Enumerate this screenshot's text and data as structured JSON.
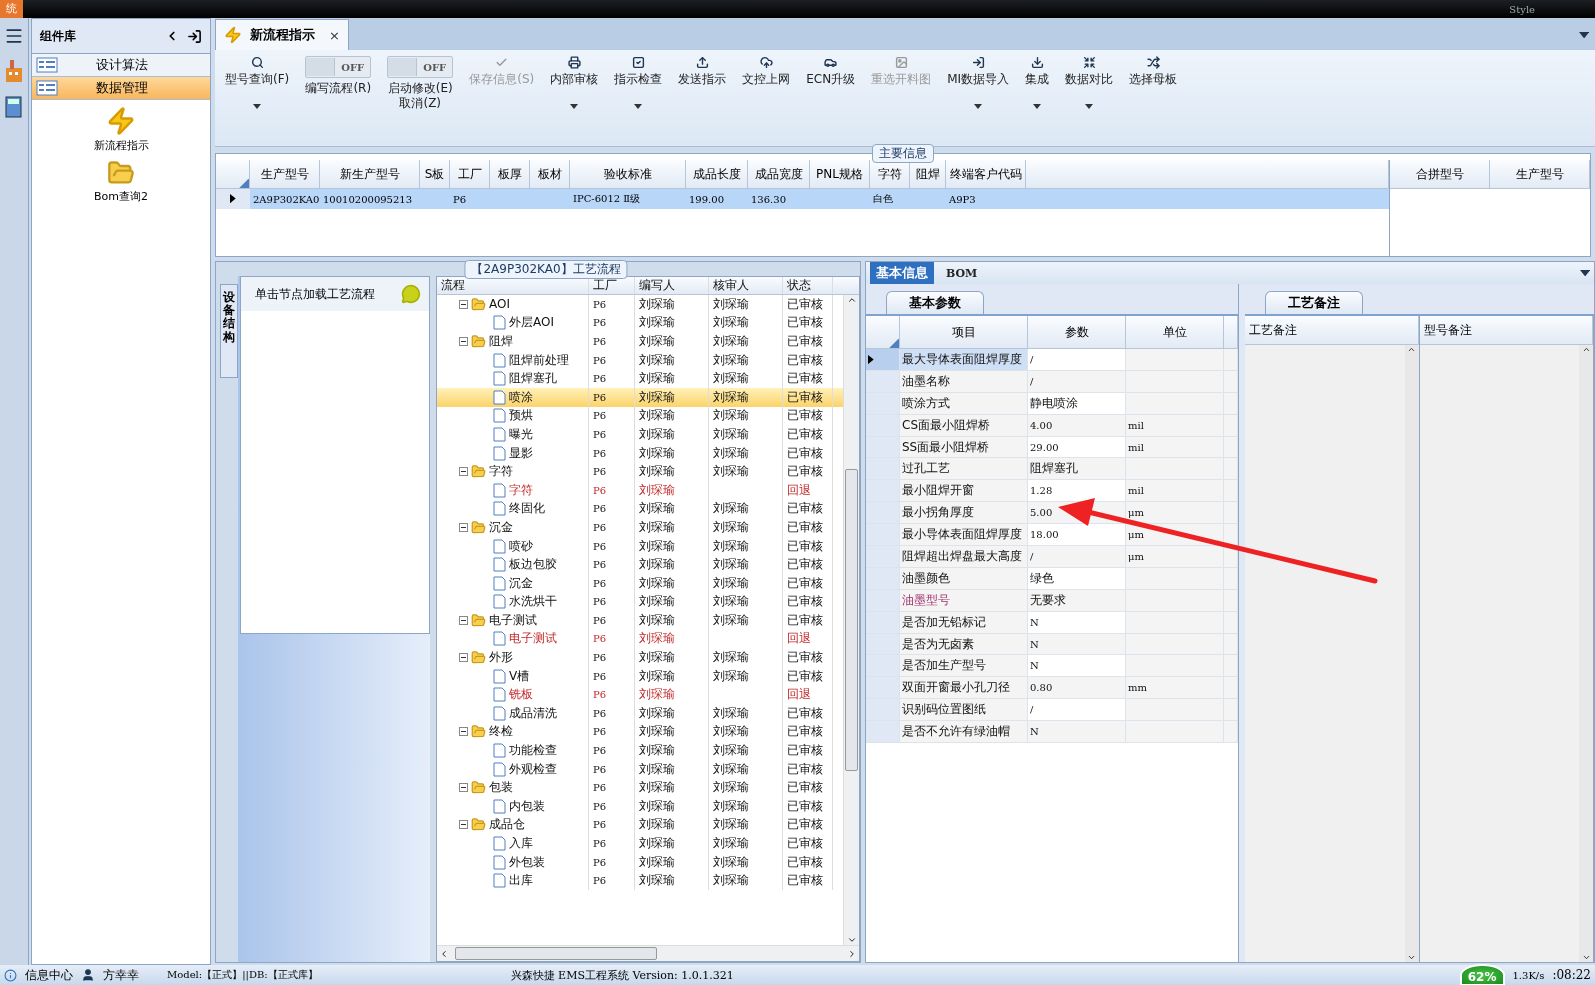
{
  "title_bar": {
    "app_fragment": "统",
    "style_menu": "Style"
  },
  "component_library": {
    "title": "组件库",
    "items": [
      {
        "label": "设计算法",
        "selected": false
      },
      {
        "label": "数据管理",
        "selected": true
      }
    ],
    "tools": [
      {
        "label": "新流程指示",
        "kind": "lightning"
      },
      {
        "label": "Bom查询2",
        "kind": "folder"
      }
    ]
  },
  "document_tab": {
    "label": "新流程指示",
    "close": "×"
  },
  "toolbar": [
    {
      "kind": "button",
      "label": "型号查询(F)",
      "disabled": false,
      "dropdown": true
    },
    {
      "kind": "toggle",
      "label": "编写流程(R)",
      "switch": "OFF",
      "on": false
    },
    {
      "kind": "toggle",
      "label": "启动修改(E)\n取消(Z)",
      "switch": "OFF",
      "on": false
    },
    {
      "kind": "button",
      "label": "保存信息(S)",
      "disabled": true,
      "dropdown": false
    },
    {
      "kind": "button",
      "label": "内部审核",
      "disabled": false,
      "dropdown": true
    },
    {
      "kind": "button",
      "label": "指示检查",
      "disabled": false,
      "dropdown": true
    },
    {
      "kind": "button",
      "label": "发送指示",
      "disabled": false,
      "dropdown": false
    },
    {
      "kind": "button",
      "label": "文控上网",
      "disabled": false,
      "dropdown": false
    },
    {
      "kind": "button",
      "label": "ECN升级",
      "disabled": false,
      "dropdown": false
    },
    {
      "kind": "button",
      "label": "重选开料图",
      "disabled": true,
      "dropdown": false
    },
    {
      "kind": "button",
      "label": "MI数据导入",
      "disabled": false,
      "dropdown": true
    },
    {
      "kind": "button",
      "label": "集成",
      "disabled": false,
      "dropdown": true
    },
    {
      "kind": "button",
      "label": "数据对比",
      "disabled": false,
      "dropdown": true
    },
    {
      "kind": "button",
      "label": "选择母板",
      "disabled": false,
      "dropdown": false
    }
  ],
  "main_info": {
    "title": "主要信息",
    "columns": [
      "生产型号",
      "新生产型号",
      "S板",
      "工厂",
      "板厚",
      "板材",
      "验收标准",
      "成品长度",
      "成品宽度",
      "PNL规格",
      "字符",
      "阻焊",
      "终端客户代码"
    ],
    "rows": [
      {
        "selected": true,
        "cells": [
          "2A9P302KA0",
          "10010200095213",
          "",
          "P6",
          "",
          "",
          "IPC-6012 Ⅱ级",
          "199.00",
          "136.30",
          "",
          "白色",
          "",
          "A9P3"
        ]
      }
    ],
    "side_columns": [
      "合拼型号",
      "生产型号"
    ]
  },
  "process": {
    "title": "【2A9P302KA0】工艺流程",
    "side_tab": "设备结构",
    "hint": "单击节点加载工艺流程",
    "columns": [
      "流程",
      "工厂",
      "编写人",
      "核审人",
      "状态"
    ],
    "tree": [
      {
        "name": "AOI",
        "factory": "P6",
        "writer": "刘琛瑜",
        "reviewer": "刘琛瑜",
        "status": "已审核",
        "returned": false,
        "selected": false,
        "children": [
          {
            "name": "外层AOI",
            "factory": "P6",
            "writer": "刘琛瑜",
            "reviewer": "刘琛瑜",
            "status": "已审核",
            "returned": false,
            "selected": false
          }
        ]
      },
      {
        "name": "阻焊",
        "factory": "P6",
        "writer": "刘琛瑜",
        "reviewer": "刘琛瑜",
        "status": "已审核",
        "returned": false,
        "selected": false,
        "children": [
          {
            "name": "阻焊前处理",
            "factory": "P6",
            "writer": "刘琛瑜",
            "reviewer": "刘琛瑜",
            "status": "已审核",
            "returned": false,
            "selected": false
          },
          {
            "name": "阻焊塞孔",
            "factory": "P6",
            "writer": "刘琛瑜",
            "reviewer": "刘琛瑜",
            "status": "已审核",
            "returned": false,
            "selected": false
          },
          {
            "name": "喷涂",
            "factory": "P6",
            "writer": "刘琛瑜",
            "reviewer": "刘琛瑜",
            "status": "已审核",
            "returned": false,
            "selected": true
          },
          {
            "name": "预烘",
            "factory": "P6",
            "writer": "刘琛瑜",
            "reviewer": "刘琛瑜",
            "status": "已审核",
            "returned": false,
            "selected": false
          },
          {
            "name": "曝光",
            "factory": "P6",
            "writer": "刘琛瑜",
            "reviewer": "刘琛瑜",
            "status": "已审核",
            "returned": false,
            "selected": false
          },
          {
            "name": "显影",
            "factory": "P6",
            "writer": "刘琛瑜",
            "reviewer": "刘琛瑜",
            "status": "已审核",
            "returned": false,
            "selected": false
          }
        ]
      },
      {
        "name": "字符",
        "factory": "P6",
        "writer": "刘琛瑜",
        "reviewer": "刘琛瑜",
        "status": "已审核",
        "returned": false,
        "selected": false,
        "children": [
          {
            "name": "字符",
            "factory": "P6",
            "writer": "刘琛瑜",
            "status": "回退",
            "returned": true,
            "selected": false
          },
          {
            "name": "终固化",
            "factory": "P6",
            "writer": "刘琛瑜",
            "reviewer": "刘琛瑜",
            "status": "已审核",
            "returned": false,
            "selected": false
          }
        ]
      },
      {
        "name": "沉金",
        "factory": "P6",
        "writer": "刘琛瑜",
        "reviewer": "刘琛瑜",
        "status": "已审核",
        "returned": false,
        "selected": false,
        "children": [
          {
            "name": "喷砂",
            "factory": "P6",
            "writer": "刘琛瑜",
            "reviewer": "刘琛瑜",
            "status": "已审核",
            "returned": false,
            "selected": false
          },
          {
            "name": "板边包胶",
            "factory": "P6",
            "writer": "刘琛瑜",
            "reviewer": "刘琛瑜",
            "status": "已审核",
            "returned": false,
            "selected": false
          },
          {
            "name": "沉金",
            "factory": "P6",
            "writer": "刘琛瑜",
            "reviewer": "刘琛瑜",
            "status": "已审核",
            "returned": false,
            "selected": false
          },
          {
            "name": "水洗烘干",
            "factory": "P6",
            "writer": "刘琛瑜",
            "reviewer": "刘琛瑜",
            "status": "已审核",
            "returned": false,
            "selected": false
          }
        ]
      },
      {
        "name": "电子测试",
        "factory": "P6",
        "writer": "刘琛瑜",
        "reviewer": "刘琛瑜",
        "status": "已审核",
        "returned": false,
        "selected": false,
        "children": [
          {
            "name": "电子测试",
            "factory": "P6",
            "writer": "刘琛瑜",
            "status": "回退",
            "returned": true,
            "selected": false
          }
        ]
      },
      {
        "name": "外形",
        "factory": "P6",
        "writer": "刘琛瑜",
        "reviewer": "刘琛瑜",
        "status": "已审核",
        "returned": false,
        "selected": false,
        "children": [
          {
            "name": "V槽",
            "factory": "P6",
            "writer": "刘琛瑜",
            "reviewer": "刘琛瑜",
            "status": "已审核",
            "returned": false,
            "selected": false
          },
          {
            "name": "铣板",
            "factory": "P6",
            "writer": "刘琛瑜",
            "status": "回退",
            "returned": true,
            "selected": false
          },
          {
            "name": "成品清洗",
            "factory": "P6",
            "writer": "刘琛瑜",
            "reviewer": "刘琛瑜",
            "status": "已审核",
            "returned": false,
            "selected": false
          }
        ]
      },
      {
        "name": "终检",
        "factory": "P6",
        "writer": "刘琛瑜",
        "reviewer": "刘琛瑜",
        "status": "已审核",
        "returned": false,
        "selected": false,
        "children": [
          {
            "name": "功能检查",
            "factory": "P6",
            "writer": "刘琛瑜",
            "reviewer": "刘琛瑜",
            "status": "已审核",
            "returned": false,
            "selected": false
          },
          {
            "name": "外观检查",
            "factory": "P6",
            "writer": "刘琛瑜",
            "reviewer": "刘琛瑜",
            "status": "已审核",
            "returned": false,
            "selected": false
          }
        ]
      },
      {
        "name": "包装",
        "factory": "P6",
        "writer": "刘琛瑜",
        "reviewer": "刘琛瑜",
        "status": "已审核",
        "returned": false,
        "selected": false,
        "children": [
          {
            "name": "内包装",
            "factory": "P6",
            "writer": "刘琛瑜",
            "reviewer": "刘琛瑜",
            "status": "已审核",
            "returned": false,
            "selected": false
          }
        ]
      },
      {
        "name": "成品仓",
        "factory": "P6",
        "writer": "刘琛瑜",
        "reviewer": "刘琛瑜",
        "status": "已审核",
        "returned": false,
        "selected": false,
        "children": [
          {
            "name": "入库",
            "factory": "P6",
            "writer": "刘琛瑜",
            "reviewer": "刘琛瑜",
            "status": "已审核",
            "returned": false,
            "selected": false
          },
          {
            "name": "外包装",
            "factory": "P6",
            "writer": "刘琛瑜",
            "reviewer": "刘琛瑜",
            "status": "已审核",
            "returned": false,
            "selected": false
          },
          {
            "name": "出库",
            "factory": "P6",
            "writer": "刘琛瑜",
            "reviewer": "刘琛瑜",
            "status": "已审核",
            "returned": false,
            "selected": false
          }
        ]
      }
    ]
  },
  "detail_tabs": [
    {
      "label": "基本信息",
      "selected": true
    },
    {
      "label": "BOM",
      "selected": false
    }
  ],
  "parameters": {
    "tab": "基本参数",
    "columns": [
      "项目",
      "参数",
      "单位"
    ],
    "rows": [
      {
        "item": "最大导体表面阻焊厚度",
        "value": "/",
        "unit": "",
        "selected": true,
        "highlighted": false
      },
      {
        "item": "油墨名称",
        "value": "/",
        "unit": "",
        "selected": false,
        "highlighted": false
      },
      {
        "item": "喷涂方式",
        "value": "静电喷涂",
        "unit": "",
        "selected": false,
        "highlighted": false
      },
      {
        "item": "CS面最小阻焊桥",
        "value": "4.00",
        "unit": "mil",
        "selected": false,
        "highlighted": false
      },
      {
        "item": "SS面最小阻焊桥",
        "value": "29.00",
        "unit": "mil",
        "selected": false,
        "highlighted": false
      },
      {
        "item": "过孔工艺",
        "value": "阻焊塞孔",
        "unit": "",
        "selected": false,
        "highlighted": false
      },
      {
        "item": "最小阻焊开窗",
        "value": "1.28",
        "unit": "mil",
        "selected": false,
        "highlighted": false
      },
      {
        "item": "最小拐角厚度",
        "value": "5.00",
        "unit": "μm",
        "selected": false,
        "highlighted": false
      },
      {
        "item": "最小导体表面阻焊厚度",
        "value": "18.00",
        "unit": "μm",
        "selected": false,
        "highlighted": false
      },
      {
        "item": "阻焊超出焊盘最大高度",
        "value": "/",
        "unit": "μm",
        "selected": false,
        "highlighted": false
      },
      {
        "item": "油墨颜色",
        "value": "绿色",
        "unit": "",
        "selected": false,
        "highlighted": false
      },
      {
        "item": "油墨型号",
        "value": "无要求",
        "unit": "",
        "selected": false,
        "highlighted": true
      },
      {
        "item": "是否加无铅标记",
        "value": "N",
        "unit": "",
        "selected": false,
        "highlighted": false
      },
      {
        "item": "是否为无卤素",
        "value": "N",
        "unit": "",
        "selected": false,
        "highlighted": false
      },
      {
        "item": "是否加生产型号",
        "value": "N",
        "unit": "",
        "selected": false,
        "highlighted": false
      },
      {
        "item": "双面开窗最小孔刀径",
        "value": "0.80",
        "unit": "mm",
        "selected": false,
        "highlighted": false
      },
      {
        "item": "识别码位置图纸",
        "value": "/",
        "unit": "",
        "selected": false,
        "highlighted": false
      },
      {
        "item": "是否不允许有绿油帽",
        "value": "N",
        "unit": "",
        "selected": false,
        "highlighted": false
      }
    ]
  },
  "remarks": {
    "tab": "工艺备注",
    "columns": [
      "工艺备注",
      "型号备注"
    ]
  },
  "status_bar": {
    "info_center": "信息中心",
    "user": "方幸幸",
    "model": "Model:【正式】||DB:【正式库】",
    "version": "兴森快捷 EMS工程系统 Version: 1.0.1.321",
    "memory": "62%",
    "speed": "1.3K/s",
    "clock": ":08:22"
  }
}
